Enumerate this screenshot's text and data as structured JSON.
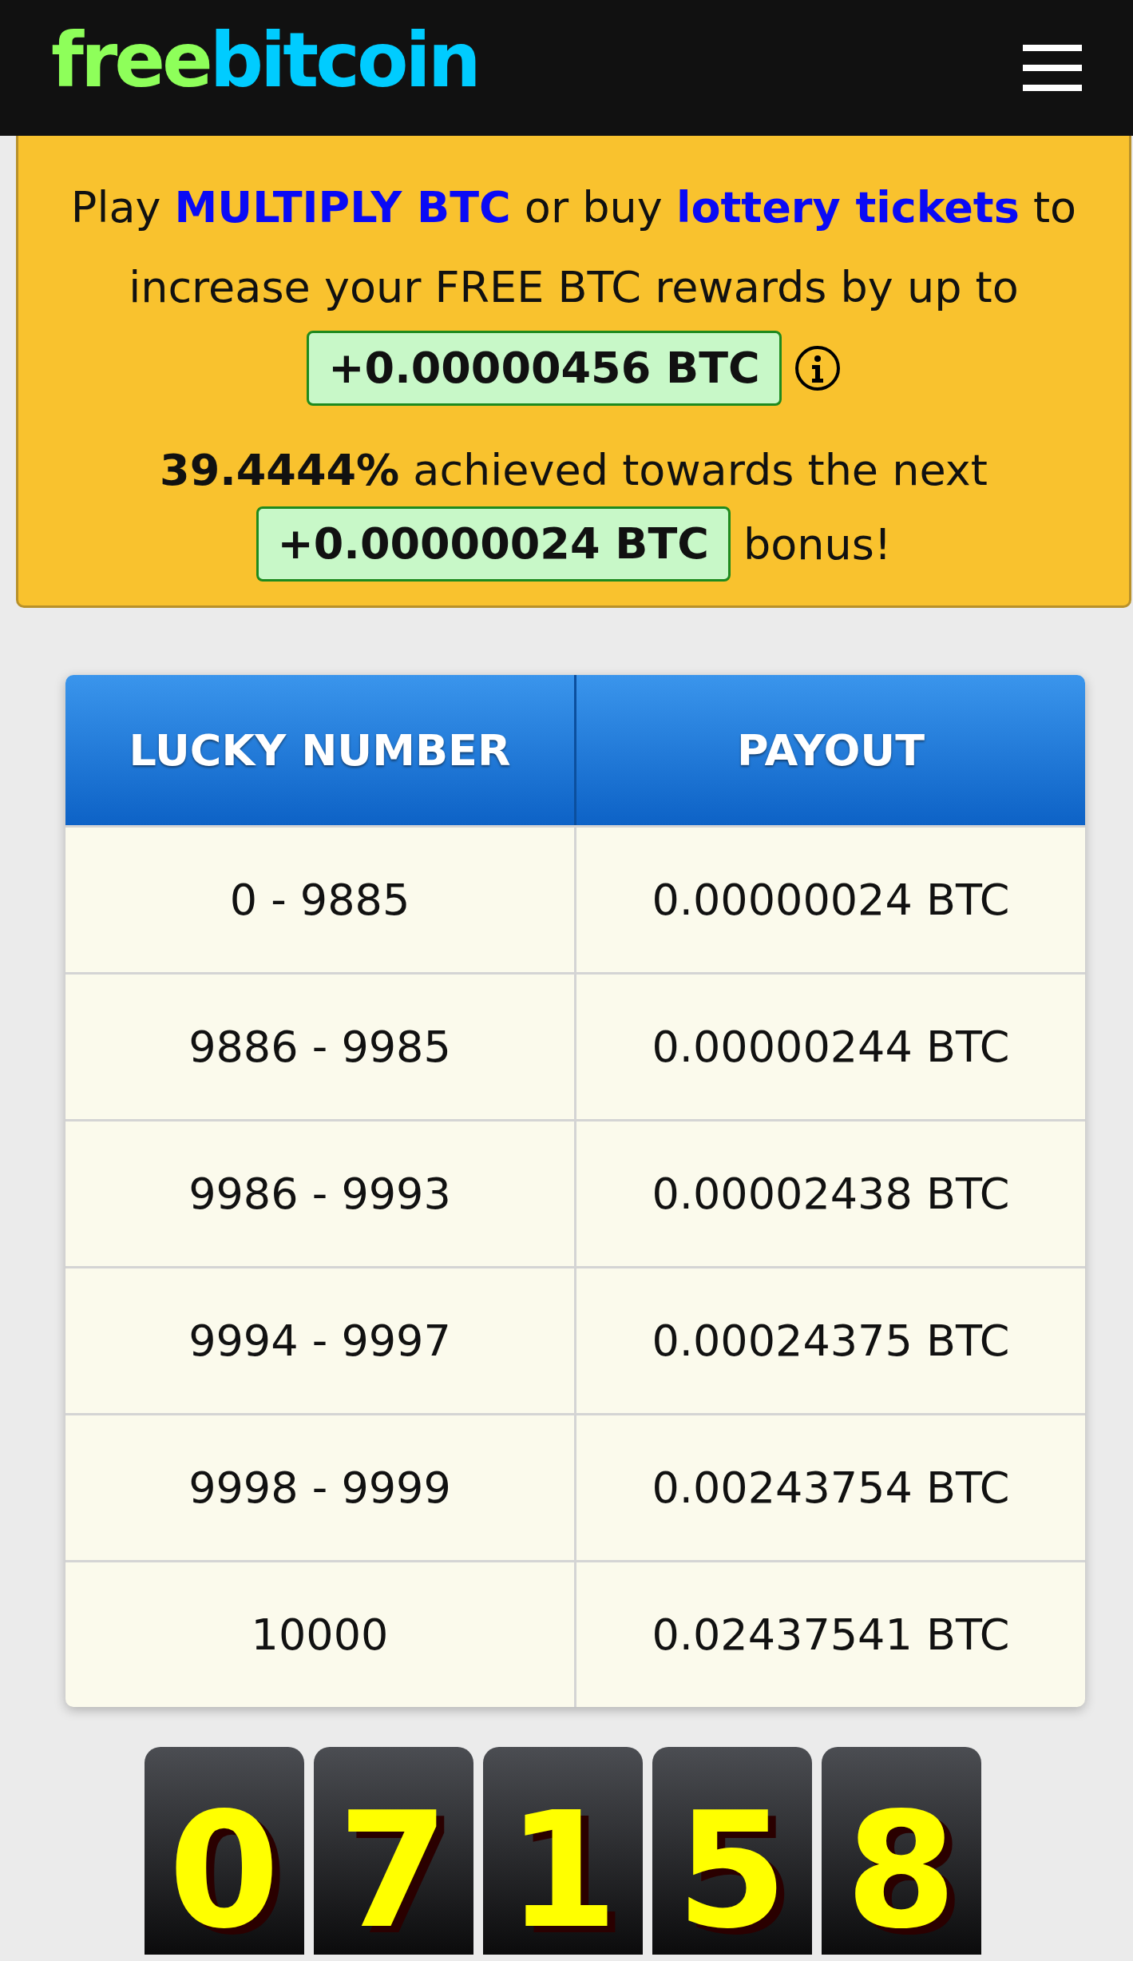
{
  "header": {
    "logo_first": "free",
    "logo_second": "bitcoin"
  },
  "banner": {
    "intro": "Play",
    "multiply_link": "MULTIPLY BTC",
    "middle": "or buy",
    "lottery_link": "lottery tickets",
    "rest": "to increase your FREE BTC rewards by up to",
    "max_bonus": "+0.00000456 BTC",
    "progress": "**39.4444%** achieved towards the next",
    "next_bonus": "+0.00000024 BTC",
    "suffix": "bonus!"
  },
  "table": {
    "columns": [
      "LUCKY NUMBER",
      "PAYOUT"
    ],
    "rows": [
      [
        "0 - 9885",
        "0.00000024 BTC"
      ],
      [
        "9886 - 9985",
        "0.00000244 BTC"
      ],
      [
        "9986 - 9993",
        "0.00002438 BTC"
      ],
      [
        "9994 - 9997",
        "0.00024375 BTC"
      ],
      [
        "9998 - 9999",
        "0.00243754 BTC"
      ],
      [
        "10000",
        "0.02437541 BTC"
      ]
    ]
  },
  "digits": [
    "0",
    "7",
    "1",
    "5",
    "8"
  ]
}
